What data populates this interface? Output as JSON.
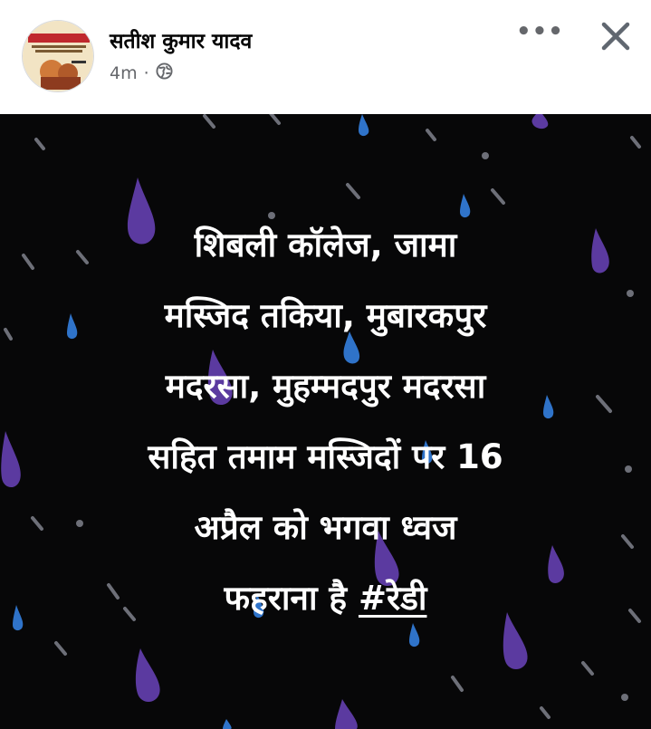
{
  "post": {
    "author_name": "सतीश कुमार यादव",
    "timestamp": "4m",
    "separator": "·",
    "privacy_icon": "globe-icon",
    "more_icon": "more-options-icon",
    "more_label": "•••",
    "close_icon": "close-icon",
    "avatar_icon": "profile-avatar"
  },
  "image": {
    "background_color": "#070708",
    "text_lines": [
      "शिबली कॉलेज, जामा",
      "मस्जिद तकिया, मुबारकपुर",
      "मदरसा, मुहम्मदपुर मदरसा",
      "सहित तमाम मस्जिदों पर 16",
      "अप्रैल को भगवा ध्वज",
      "फहराना है"
    ],
    "hashtag": "#रेडी",
    "colors": {
      "drop_purple": "#5b3aa0",
      "drop_blue": "#2f73c9",
      "drop_grey": "#6d6f78"
    }
  }
}
